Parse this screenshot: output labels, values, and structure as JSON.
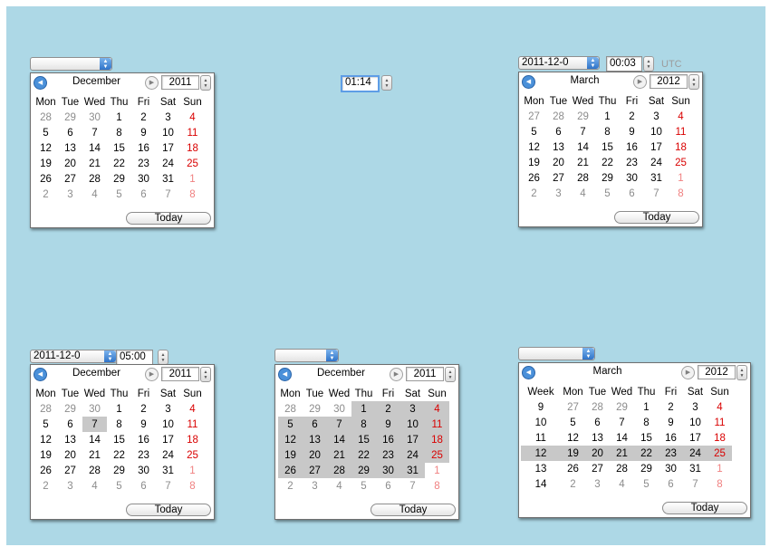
{
  "background": "#add8e6",
  "colors": {
    "weekend": "#d90000",
    "selection": "#c8c8c8",
    "accent": "#4a90d9"
  },
  "middle_time": {
    "value": "01:14"
  },
  "topright_controls": {
    "date": "2011-12-0",
    "time": "00:03",
    "tz": "UTC"
  },
  "bottomleft_controls": {
    "date": "2011-12-0",
    "time": "05:00"
  },
  "cal_dec_a": {
    "month": "December",
    "year": "2011",
    "today_label": "Today",
    "weekdays": [
      "Mon",
      "Tue",
      "Wed",
      "Thu",
      "Fri",
      "Sat",
      "Sun"
    ],
    "weeks": [
      [
        "28",
        "29",
        "30",
        "1",
        "2",
        "3",
        "4"
      ],
      [
        "5",
        "6",
        "7",
        "8",
        "9",
        "10",
        "11"
      ],
      [
        "12",
        "13",
        "14",
        "15",
        "16",
        "17",
        "18"
      ],
      [
        "19",
        "20",
        "21",
        "22",
        "23",
        "24",
        "25"
      ],
      [
        "26",
        "27",
        "28",
        "29",
        "30",
        "31",
        "1"
      ],
      [
        "2",
        "3",
        "4",
        "5",
        "6",
        "7",
        "8"
      ]
    ]
  },
  "cal_mar_a": {
    "month": "March",
    "year": "2012",
    "today_label": "Today",
    "weekdays": [
      "Mon",
      "Tue",
      "Wed",
      "Thu",
      "Fri",
      "Sat",
      "Sun"
    ],
    "weeks": [
      [
        "27",
        "28",
        "29",
        "1",
        "2",
        "3",
        "4"
      ],
      [
        "5",
        "6",
        "7",
        "8",
        "9",
        "10",
        "11"
      ],
      [
        "12",
        "13",
        "14",
        "15",
        "16",
        "17",
        "18"
      ],
      [
        "19",
        "20",
        "21",
        "22",
        "23",
        "24",
        "25"
      ],
      [
        "26",
        "27",
        "28",
        "29",
        "30",
        "31",
        "1"
      ],
      [
        "2",
        "3",
        "4",
        "5",
        "6",
        "7",
        "8"
      ]
    ]
  },
  "cal_dec_b": {
    "month": "December",
    "year": "2011",
    "today_label": "Today",
    "selected_date": "7",
    "weekdays": [
      "Mon",
      "Tue",
      "Wed",
      "Thu",
      "Fri",
      "Sat",
      "Sun"
    ],
    "weeks": [
      [
        "28",
        "29",
        "30",
        "1",
        "2",
        "3",
        "4"
      ],
      [
        "5",
        "6",
        "7",
        "8",
        "9",
        "10",
        "11"
      ],
      [
        "12",
        "13",
        "14",
        "15",
        "16",
        "17",
        "18"
      ],
      [
        "19",
        "20",
        "21",
        "22",
        "23",
        "24",
        "25"
      ],
      [
        "26",
        "27",
        "28",
        "29",
        "30",
        "31",
        "1"
      ],
      [
        "2",
        "3",
        "4",
        "5",
        "6",
        "7",
        "8"
      ]
    ]
  },
  "cal_dec_c": {
    "month": "December",
    "year": "2011",
    "today_label": "Today",
    "selected_range": "1 – 31",
    "weekdays": [
      "Mon",
      "Tue",
      "Wed",
      "Thu",
      "Fri",
      "Sat",
      "Sun"
    ],
    "weeks": [
      [
        "28",
        "29",
        "30",
        "1",
        "2",
        "3",
        "4"
      ],
      [
        "5",
        "6",
        "7",
        "8",
        "9",
        "10",
        "11"
      ],
      [
        "12",
        "13",
        "14",
        "15",
        "16",
        "17",
        "18"
      ],
      [
        "19",
        "20",
        "21",
        "22",
        "23",
        "24",
        "25"
      ],
      [
        "26",
        "27",
        "28",
        "29",
        "30",
        "31",
        "1"
      ],
      [
        "2",
        "3",
        "4",
        "5",
        "6",
        "7",
        "8"
      ]
    ]
  },
  "cal_mar_week": {
    "month": "March",
    "year": "2012",
    "today_label": "Today",
    "week_label": "Week",
    "selected_week": "12",
    "weekdays": [
      "Mon",
      "Tue",
      "Wed",
      "Thu",
      "Fri",
      "Sat",
      "Sun"
    ],
    "week_numbers": [
      "9",
      "10",
      "11",
      "12",
      "13",
      "14"
    ],
    "weeks": [
      [
        "27",
        "28",
        "29",
        "1",
        "2",
        "3",
        "4"
      ],
      [
        "5",
        "6",
        "7",
        "8",
        "9",
        "10",
        "11"
      ],
      [
        "12",
        "13",
        "14",
        "15",
        "16",
        "17",
        "18"
      ],
      [
        "19",
        "20",
        "21",
        "22",
        "23",
        "24",
        "25"
      ],
      [
        "26",
        "27",
        "28",
        "29",
        "30",
        "31",
        "1"
      ],
      [
        "2",
        "3",
        "4",
        "5",
        "6",
        "7",
        "8"
      ]
    ]
  }
}
